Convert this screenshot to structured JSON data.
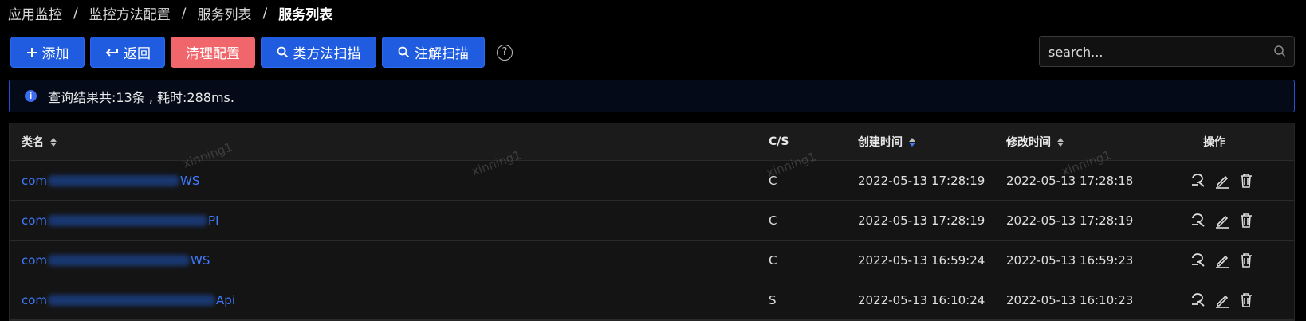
{
  "breadcrumb": {
    "items": [
      "应用监控",
      "监控方法配置",
      "服务列表",
      "服务列表"
    ]
  },
  "toolbar": {
    "add_label": "添加",
    "back_label": "返回",
    "clear_label": "清理配置",
    "class_scan_label": "类方法扫描",
    "annotation_scan_label": "注解扫描",
    "help_glyph": "?"
  },
  "search": {
    "placeholder": "search..."
  },
  "alert": {
    "text": "查询结果共:13条 , 耗时:288ms."
  },
  "table": {
    "headers": {
      "name": "类名",
      "cs": "C/S",
      "created": "创建时间",
      "modified": "修改时间",
      "ops": "操作"
    },
    "rows": [
      {
        "name_prefix": "com",
        "name_suffix": "WS",
        "cs": "C",
        "created": "2022-05-13 17:28:19",
        "modified": "2022-05-13 17:28:18"
      },
      {
        "name_prefix": "com",
        "name_suffix": "PI",
        "cs": "C",
        "created": "2022-05-13 17:28:19",
        "modified": "2022-05-13 17:28:19"
      },
      {
        "name_prefix": "com",
        "name_suffix": "WS",
        "cs": "C",
        "created": "2022-05-13 16:59:24",
        "modified": "2022-05-13 16:59:23"
      },
      {
        "name_prefix": "com",
        "name_suffix": "Api",
        "cs": "S",
        "created": "2022-05-13 16:10:24",
        "modified": "2022-05-13 16:10:23"
      }
    ]
  },
  "watermark": "xinning1",
  "colors": {
    "primary": "#1f5ce0",
    "danger": "#f1666a",
    "link": "#3f7bff",
    "background": "#000000"
  },
  "icons": [
    "plus-icon",
    "return-arrow-icon",
    "search-icon",
    "question-icon",
    "info-icon",
    "sort-icon",
    "scan-icon",
    "edit-icon",
    "delete-icon"
  ]
}
